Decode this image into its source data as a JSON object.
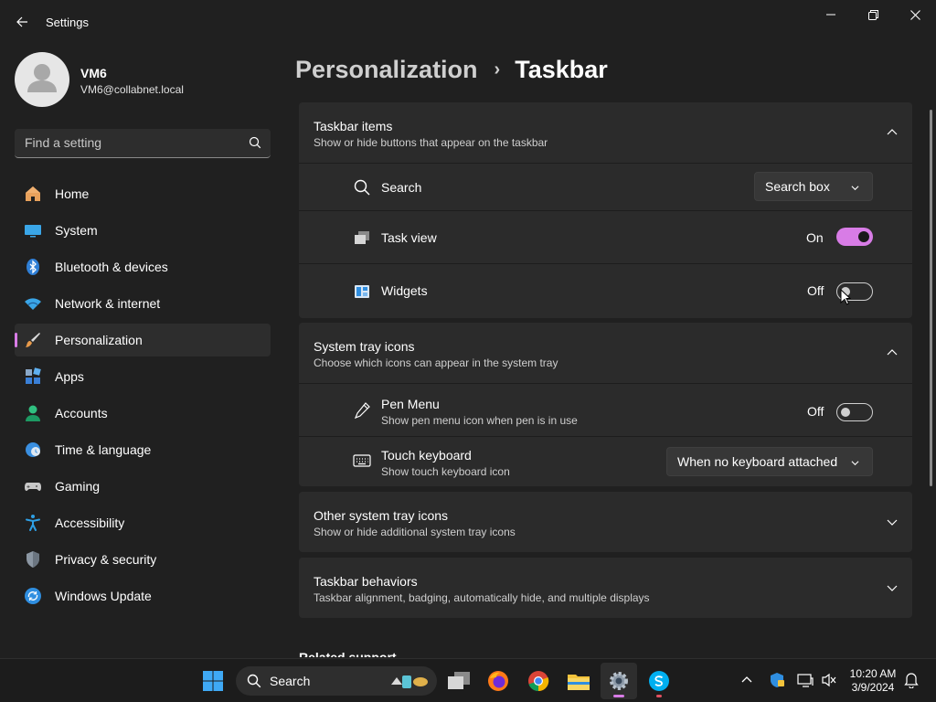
{
  "window": {
    "title": "Settings",
    "back_icon": "back-arrow-icon",
    "controls": [
      "minimize-icon",
      "restore-icon",
      "close-icon"
    ]
  },
  "profile": {
    "name": "VM6",
    "email": "VM6@collabnet.local"
  },
  "search": {
    "placeholder": "Find a setting"
  },
  "sidebar": {
    "items": [
      {
        "label": "Home",
        "icon": "home-icon",
        "active": false
      },
      {
        "label": "System",
        "icon": "system-icon",
        "active": false
      },
      {
        "label": "Bluetooth & devices",
        "icon": "bluetooth-icon",
        "active": false
      },
      {
        "label": "Network & internet",
        "icon": "wifi-icon",
        "active": false
      },
      {
        "label": "Personalization",
        "icon": "brush-icon",
        "active": true
      },
      {
        "label": "Apps",
        "icon": "apps-icon",
        "active": false
      },
      {
        "label": "Accounts",
        "icon": "accounts-icon",
        "active": false
      },
      {
        "label": "Time & language",
        "icon": "clock-globe-icon",
        "active": false
      },
      {
        "label": "Gaming",
        "icon": "gamepad-icon",
        "active": false
      },
      {
        "label": "Accessibility",
        "icon": "accessibility-icon",
        "active": false
      },
      {
        "label": "Privacy & security",
        "icon": "shield-icon",
        "active": false
      },
      {
        "label": "Windows Update",
        "icon": "update-icon",
        "active": false
      }
    ]
  },
  "breadcrumb": {
    "parent": "Personalization",
    "separator": "›",
    "current": "Taskbar"
  },
  "taskbar_items": {
    "title": "Taskbar items",
    "subtitle": "Show or hide buttons that appear on the taskbar",
    "rows": {
      "search": {
        "label": "Search",
        "value": "Search box"
      },
      "task_view": {
        "label": "Task view",
        "state": "On",
        "on": true
      },
      "widgets": {
        "label": "Widgets",
        "state": "Off",
        "on": false
      }
    }
  },
  "system_tray": {
    "title": "System tray icons",
    "subtitle": "Choose which icons can appear in the system tray",
    "rows": {
      "pen_menu": {
        "label": "Pen Menu",
        "sub": "Show pen menu icon when pen is in use",
        "state": "Off",
        "on": false
      },
      "touch_keyboard": {
        "label": "Touch keyboard",
        "sub": "Show touch keyboard icon",
        "value": "When no keyboard attached"
      }
    }
  },
  "other_tray": {
    "title": "Other system tray icons",
    "subtitle": "Show or hide additional system tray icons"
  },
  "behaviors": {
    "title": "Taskbar behaviors",
    "subtitle": "Taskbar alignment, badging, automatically hide, and multiple displays"
  },
  "related": {
    "title": "Related support"
  },
  "taskbar": {
    "search_label": "Search",
    "apps": [
      "start-icon",
      "task-view-icon",
      "firefox-icon",
      "chrome-icon",
      "file-explorer-icon",
      "settings-icon",
      "skype-icon"
    ],
    "tray": [
      "chevron-up-icon",
      "defender-icon",
      "network-icon",
      "volume-muted-icon",
      "notification-bell-icon"
    ],
    "time": "10:20 AM",
    "date": "3/9/2024"
  },
  "colors": {
    "accent": "#d87ce6",
    "background": "#202020",
    "card": "#2b2b2b"
  }
}
